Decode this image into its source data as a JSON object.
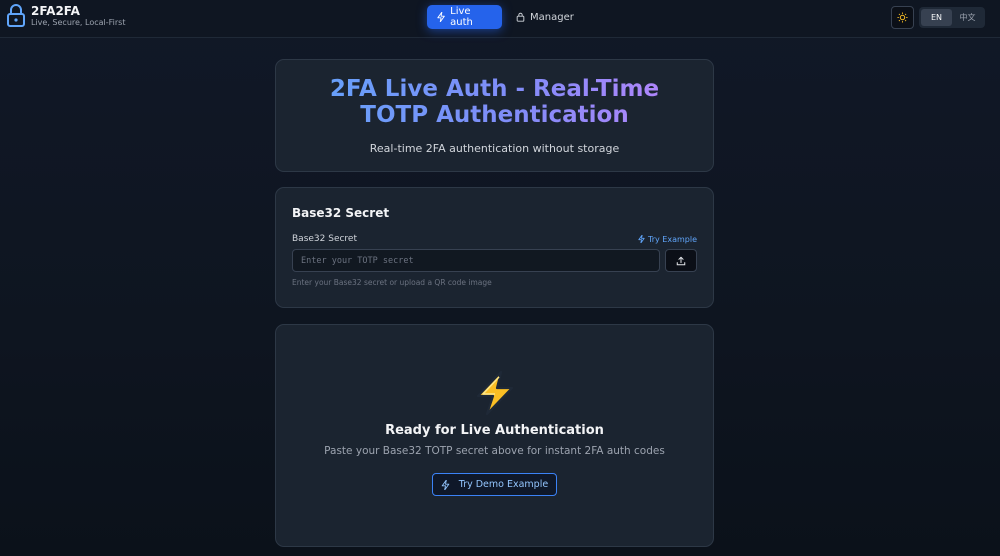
{
  "brand": {
    "title": "2FA2FA",
    "subtitle": "Live, Secure, Local-First"
  },
  "nav": {
    "live_auth": "Live auth",
    "manager": "Manager"
  },
  "lang": {
    "en": "EN",
    "zh": "中文"
  },
  "hero": {
    "title": "2FA Live Auth - Real-Time TOTP Authentication",
    "subtitle": "Real-time 2FA authentication without storage"
  },
  "secret": {
    "title": "Base32 Secret",
    "label": "Base32 Secret",
    "try_example": "Try Example",
    "placeholder": "Enter your TOTP secret",
    "value": "",
    "hint": "Enter your Base32 secret or upload a QR code image"
  },
  "ready": {
    "title": "Ready for Live Authentication",
    "subtitle": "Paste your Base32 TOTP secret above for instant 2FA auth codes",
    "demo_button": "Try Demo Example"
  },
  "colors": {
    "accent": "#2563eb",
    "link": "#60a5fa",
    "card_bg": "#1b2430",
    "page_bg": "#111827"
  },
  "icons": {
    "brand": "lock-icon",
    "live_auth": "zap-icon",
    "manager": "lock-icon",
    "theme": "sun-icon",
    "try_example": "sparkle-icon",
    "upload": "upload-icon",
    "ready": "lightning-emoji-icon",
    "demo": "zap-icon"
  }
}
